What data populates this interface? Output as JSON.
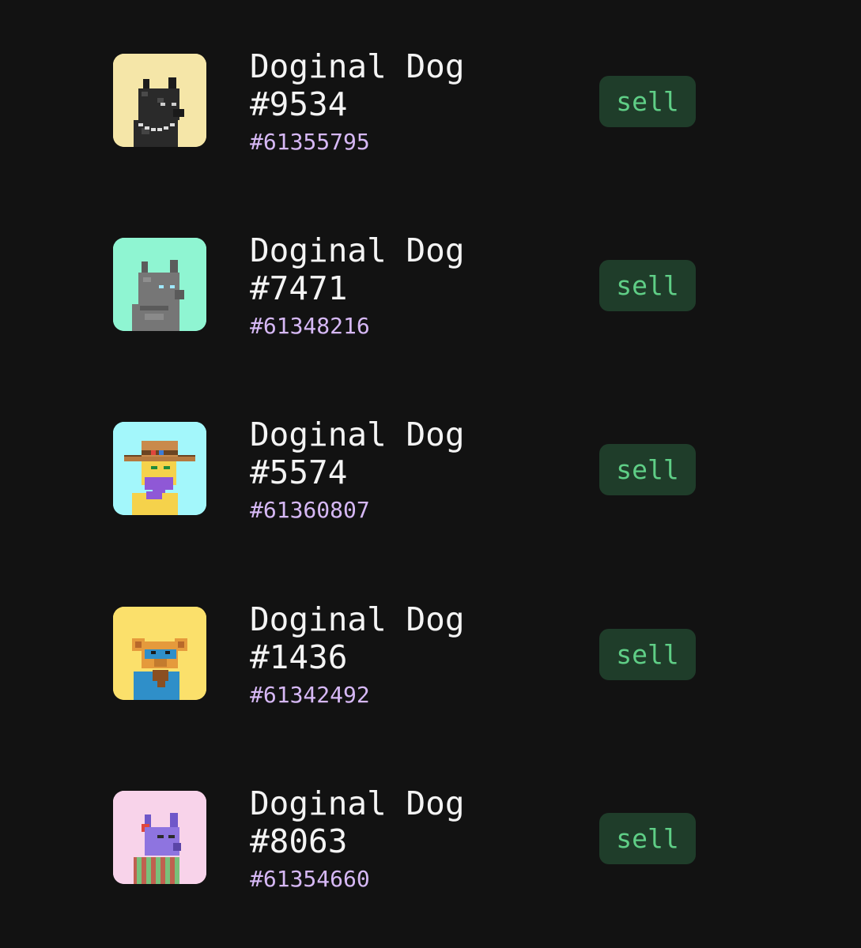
{
  "items": [
    {
      "name": "Doginal Dog",
      "number": "#9534",
      "inscription": "#61355795",
      "sell_label": "sell",
      "bg_color": "#f5e6a8",
      "avatar_icon": "black-dog-chain-avatar-icon"
    },
    {
      "name": "Doginal Dog",
      "number": "#7471",
      "inscription": "#61348216",
      "sell_label": "sell",
      "bg_color": "#8ff5d2",
      "avatar_icon": "grey-dog-avatar-icon"
    },
    {
      "name": "Doginal Dog",
      "number": "#5574",
      "inscription": "#61360807",
      "sell_label": "sell",
      "bg_color": "#a3f7fb",
      "avatar_icon": "cowboy-hat-dog-avatar-icon"
    },
    {
      "name": "Doginal Dog",
      "number": "#1436",
      "inscription": "#61342492",
      "sell_label": "sell",
      "bg_color": "#fbe06b",
      "avatar_icon": "bear-ear-dog-avatar-icon"
    },
    {
      "name": "Doginal Dog",
      "number": "#8063",
      "inscription": "#61354660",
      "sell_label": "sell",
      "bg_color": "#f8d3ea",
      "avatar_icon": "purple-dog-avatar-icon"
    }
  ],
  "colors": {
    "background": "#121212",
    "title_text": "#f4f4f4",
    "inscription_text": "#d6b8f5",
    "sell_bg": "#1f3d2a",
    "sell_text": "#5fce86"
  }
}
